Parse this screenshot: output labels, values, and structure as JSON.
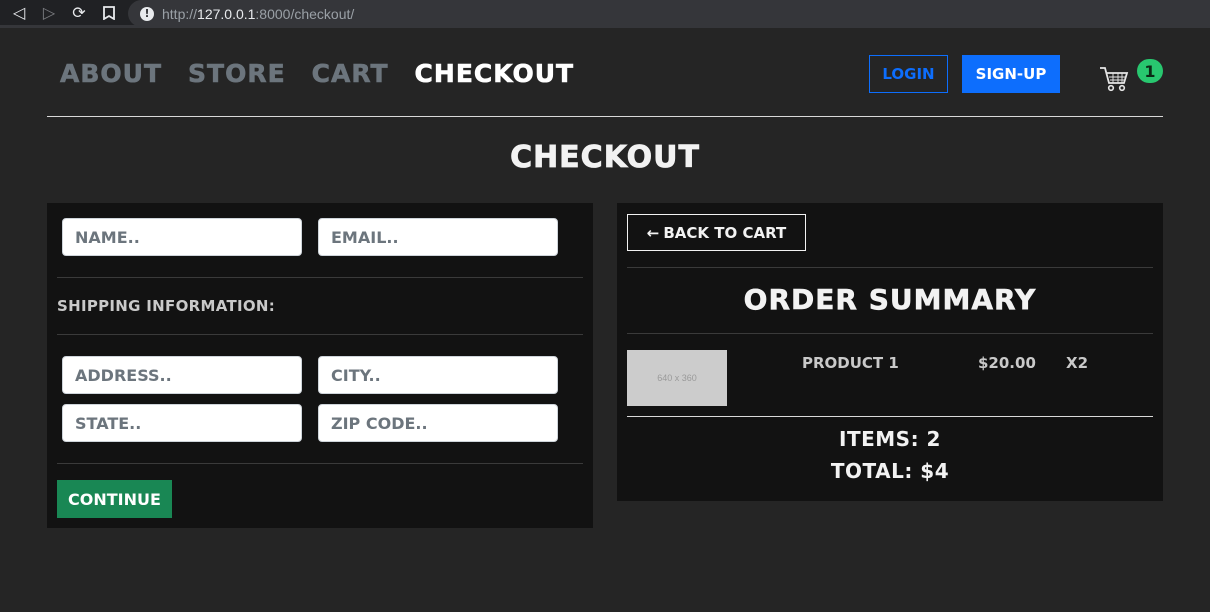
{
  "browser": {
    "url_scheme": "http://",
    "url_host": "127.0.0.1",
    "url_rest": ":8000/checkout/"
  },
  "nav": {
    "links": [
      "ABOUT",
      "STORE",
      "CART",
      "CHECKOUT"
    ],
    "active": "CHECKOUT",
    "login_label": "LOGIN",
    "signup_label": "SIGN-UP",
    "cart_count": "1"
  },
  "page": {
    "title": "CHECKOUT"
  },
  "form": {
    "name_placeholder": "NAME..",
    "email_placeholder": "EMAIL..",
    "shipping_label": "SHIPPING INFORMATION:",
    "address_placeholder": "ADDRESS..",
    "city_placeholder": "CITY..",
    "state_placeholder": "STATE..",
    "zip_placeholder": "ZIP CODE..",
    "continue_label": "CONTINUE"
  },
  "summary": {
    "back_arrow": "←",
    "back_label": "BACK TO CART",
    "title": "ORDER SUMMARY",
    "item": {
      "image_text": "640 x 360",
      "name": "PRODUCT 1",
      "price": "$20.00",
      "qty": "X2"
    },
    "items_line": "ITEMS: 2",
    "total_line": "TOTAL: $4"
  },
  "colors": {
    "background": "#252525",
    "panel": "#121212",
    "primary": "#0d6efd",
    "success": "#198754",
    "badge": "#28c76f"
  }
}
